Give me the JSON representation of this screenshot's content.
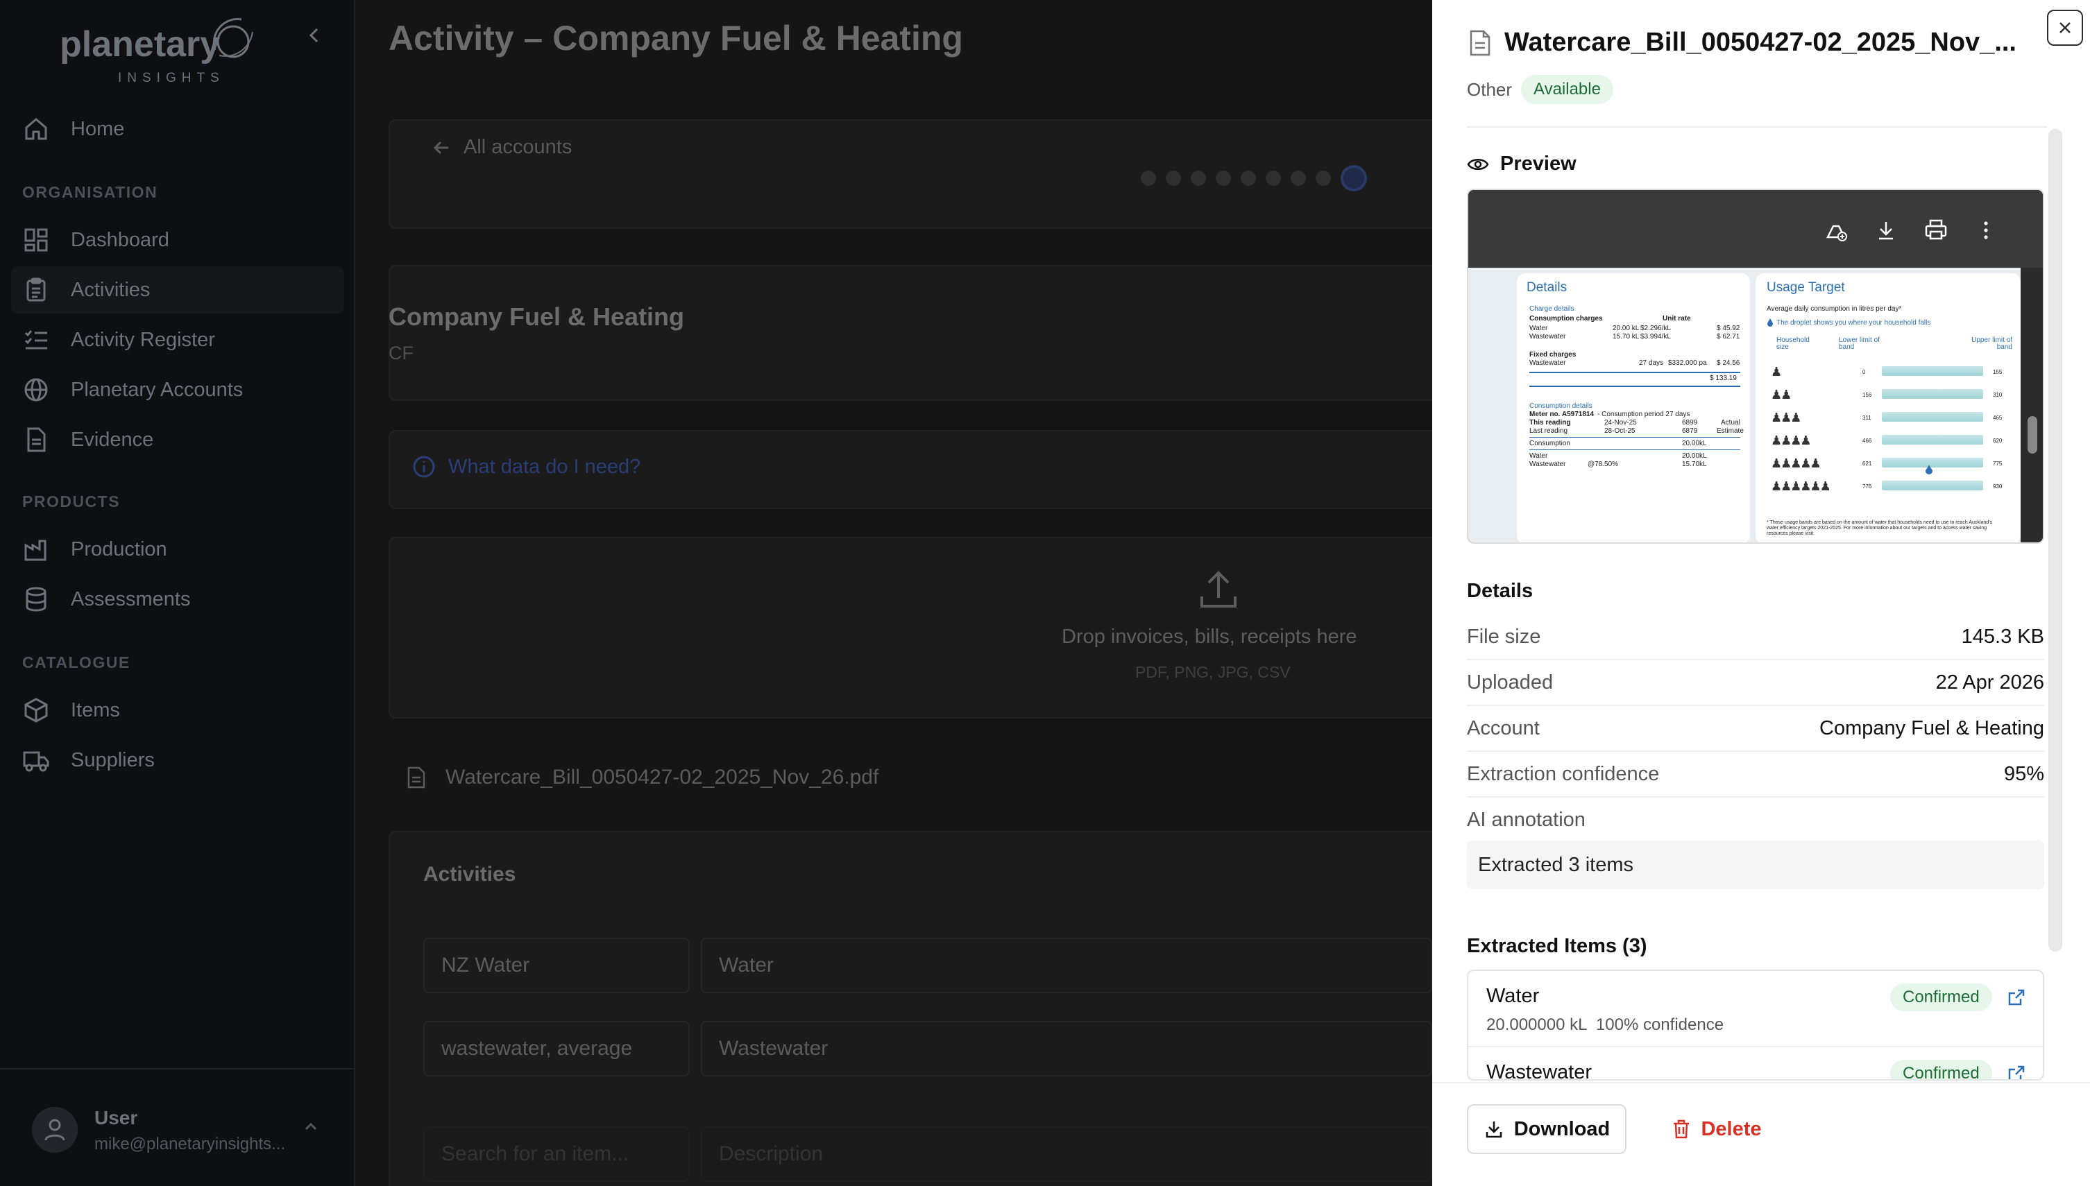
{
  "app": {
    "logo_word": "planetary",
    "logo_sub": "INSIGHTS"
  },
  "sidebar": {
    "items": [
      {
        "label": "Home",
        "icon": "home-icon"
      },
      {
        "label": "Dashboard",
        "icon": "dashboard-icon"
      },
      {
        "label": "Activities",
        "icon": "clipboard-icon"
      },
      {
        "label": "Activity Register",
        "icon": "list-check-icon"
      },
      {
        "label": "Planetary Accounts",
        "icon": "globe-icon"
      },
      {
        "label": "Evidence",
        "icon": "document-icon"
      },
      {
        "label": "Production",
        "icon": "factory-icon"
      },
      {
        "label": "Assessments",
        "icon": "database-icon"
      },
      {
        "label": "Items",
        "icon": "box-icon"
      },
      {
        "label": "Suppliers",
        "icon": "truck-icon"
      }
    ],
    "sections": {
      "organisation": "ORGANISATION",
      "products": "PRODUCTS",
      "catalogue": "CATALOGUE"
    },
    "user": {
      "name": "User",
      "email": "mike@planetaryinsights..."
    }
  },
  "main": {
    "title": "Activity – Company Fuel & Heating",
    "back_label": "All accounts",
    "account_title": "Company Fuel & Heating",
    "account_code": "CF",
    "info_link": "What data do I need?",
    "drop_title": "Drop invoices, bills, receipts here",
    "drop_sub": "PDF, PNG, JPG, CSV",
    "file_name": "Watercare_Bill_0050427-02_2025_Nov_26.pdf",
    "activities_heading": "Activities",
    "rows": [
      {
        "item": "NZ Water",
        "desc": "Water"
      },
      {
        "item": "wastewater, average",
        "desc": "Wastewater"
      }
    ],
    "search_placeholder": "Search for an item...",
    "desc_placeholder": "Description"
  },
  "drawer": {
    "title": "Watercare_Bill_0050427-02_2025_Nov_...",
    "type": "Other",
    "status": "Available",
    "preview_heading": "Preview",
    "details_heading": "Details",
    "details": [
      {
        "key": "File size",
        "value": "145.3 KB"
      },
      {
        "key": "Uploaded",
        "value": "22 Apr 2026"
      },
      {
        "key": "Account",
        "value": "Company Fuel & Heating"
      },
      {
        "key": "Extraction confidence",
        "value": "95%"
      }
    ],
    "ai_label": "AI annotation",
    "ai_value": "Extracted 3 items",
    "items_heading": "Extracted Items (3)",
    "items": [
      {
        "name": "Water",
        "meta": "20.000000 kL  100% confidence",
        "status": "Confirmed"
      },
      {
        "name": "Wastewater",
        "meta": "",
        "status": "Confirmed"
      }
    ],
    "download_label": "Download",
    "delete_label": "Delete"
  },
  "bill_preview": {
    "details_h": "Details",
    "charge_details": "Charge details",
    "consumption_charges": "Consumption charges",
    "unit_rate": "Unit rate",
    "water_line": "Water",
    "water_qty": "20.00 kL",
    "water_rate": "$2.296/kL",
    "water_amt": "$ 45.92",
    "ww_line": "Wastewater",
    "ww_qty": "15.70 kL",
    "ww_rate": "$3.994/kL",
    "ww_amt": "$ 62.71",
    "fixed": "Fixed charges",
    "fixed_line": "Wastewater",
    "fixed_days": "27 days",
    "fixed_rate": "$332.000 pa",
    "fixed_amt": "$ 24.56",
    "total": "$ 133.19",
    "cons_details": "Consumption details",
    "meter": "Meter no. A5971814",
    "meter_period": "- Consumption period 27 days",
    "this_reading": "This reading",
    "this_date": "24-Nov-25",
    "this_val": "6899",
    "this_type": "Actual",
    "last_reading": "Last reading",
    "last_date": "28-Oct-25",
    "last_val": "6879",
    "last_type": "Estimate",
    "consumption": "Consumption",
    "consumption_val": "20.00kL",
    "water2": "Water",
    "water2_val": "20.00kL",
    "ww2": "Wastewater",
    "ww2_pct": "@78.50%",
    "ww2_val": "15.70kL",
    "usage_h": "Usage Target",
    "usage_sub": "Average daily consumption in litres per day*",
    "droplet_note": "The droplet shows you where your household falls",
    "col_size": "Household size",
    "col_lower": "Lower limit of band",
    "col_upper": "Upper limit of band",
    "bands": [
      {
        "lower": "0",
        "upper": "155"
      },
      {
        "lower": "156",
        "upper": "310"
      },
      {
        "lower": "311",
        "upper": "465"
      },
      {
        "lower": "466",
        "upper": "620"
      },
      {
        "lower": "621",
        "upper": "775"
      },
      {
        "lower": "776",
        "upper": "930"
      }
    ],
    "footnote": "* These usage bands are based on the amount of water that households need to use to reach Auckland's water efficiency targets 2021-2025. For more information about our targets and to access water saving resources please visit"
  },
  "colors": {
    "accent_blue": "#2c6fb4",
    "success_bg": "#e6f6ea",
    "success_fg": "#1e6b36",
    "danger": "#d93025"
  }
}
